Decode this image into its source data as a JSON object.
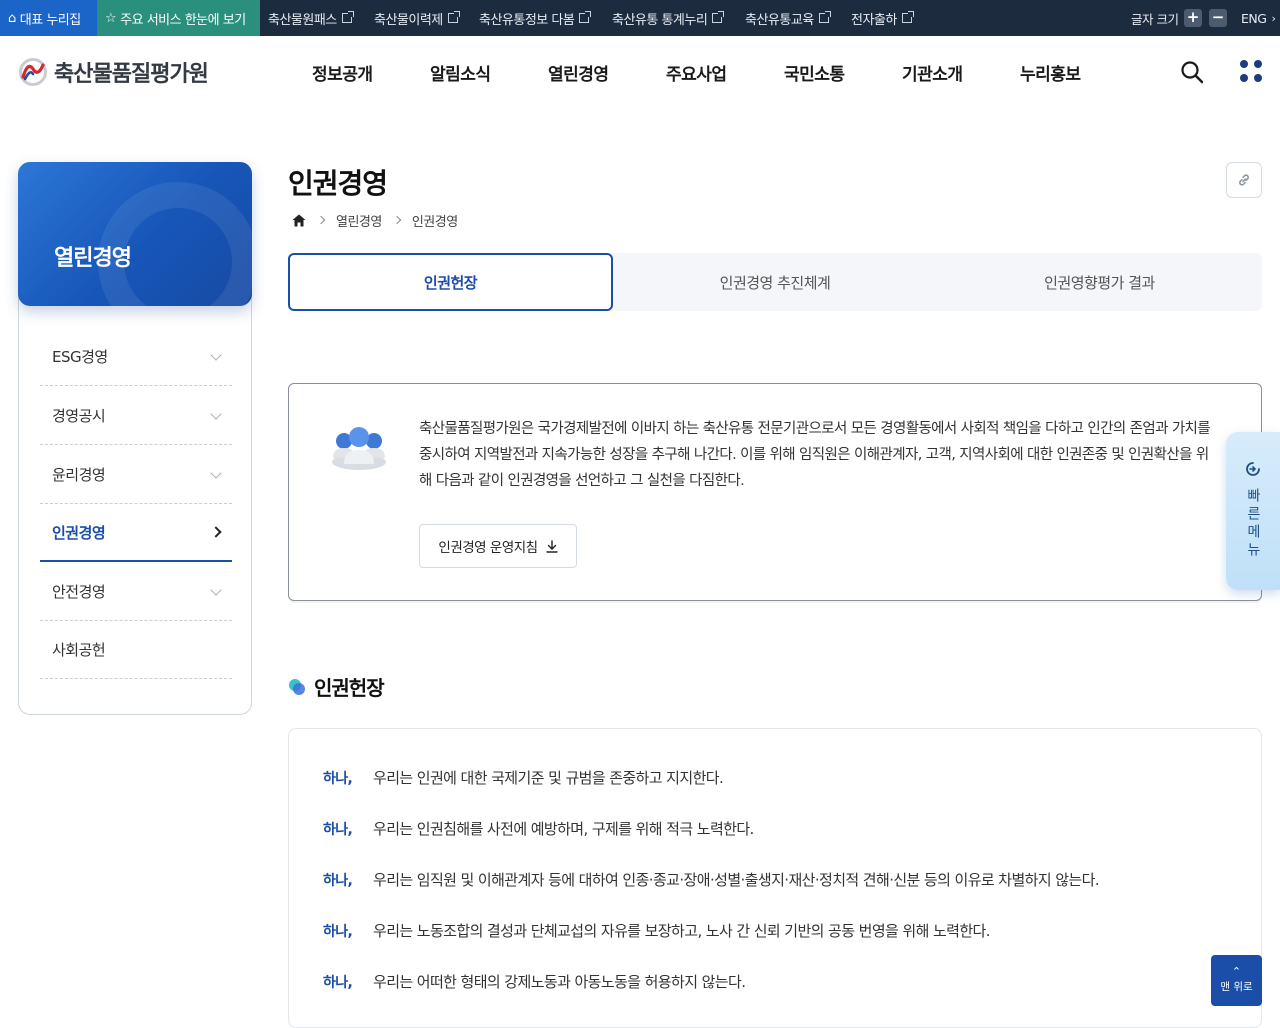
{
  "topbar": {
    "home": "대표 누리집",
    "services": "주요 서비스 한눈에 보기",
    "links": [
      "축산물원패스",
      "축산물이력제",
      "축산유통정보 다봄",
      "축산유통 통계누리",
      "축산유통교육",
      "전자출하"
    ],
    "font_size_label": "글자 크기",
    "plus": "+",
    "minus": "−",
    "lang": "ENG"
  },
  "header": {
    "logo_text": "축산물품질평가원",
    "nav": [
      "정보공개",
      "알림소식",
      "열린경영",
      "주요사업",
      "국민소통",
      "기관소개",
      "누리홍보"
    ],
    "search_icon": "search-icon",
    "menu_icon": "all-menu-icon"
  },
  "sidebar": {
    "title": "열린경영",
    "items": [
      {
        "label": "ESG경영",
        "state": "collapsed"
      },
      {
        "label": "경영공시",
        "state": "collapsed"
      },
      {
        "label": "윤리경영",
        "state": "collapsed"
      },
      {
        "label": "인권경영",
        "state": "active"
      },
      {
        "label": "안전경영",
        "state": "collapsed"
      },
      {
        "label": "사회공헌",
        "state": "none"
      }
    ]
  },
  "page": {
    "title": "인권경영",
    "breadcrumb": [
      "열린경영",
      "인권경영"
    ],
    "tabs": [
      "인권헌장",
      "인권경영 추진체계",
      "인권영향평가 결과"
    ],
    "active_tab": "인권헌장"
  },
  "intro": {
    "text": "축산물품질평가원은 국가경제발전에 이바지 하는 축산유통 전문기관으로서 모든 경영활동에서 사회적 책임을 다하고 인간의 존엄과 가치를 중시하여 지역발전과 지속가능한 성장을 추구해 나간다. 이를 위해 임직원은 이해관계자, 고객, 지역사회에 대한 인권존중 및 인권확산을 위해 다음과 같이 인권경영을 선언하고 그 실천을 다짐한다.",
    "download_label": "인권경영 운영지침"
  },
  "charter": {
    "title": "인권헌장",
    "lead": "하나,",
    "items": [
      "우리는 인권에 대한 국제기준 및 규범을 존중하고 지지한다.",
      "우리는 인권침해를 사전에 예방하며, 구제를 위해 적극 노력한다.",
      "우리는 임직원 및 이해관계자 등에 대하여 인종·종교·장애·성별·출생지·재산·정치적 견해·신분 등의 이유로 차별하지 않는다.",
      "우리는 노동조합의 결성과 단체교섭의 자유를 보장하고, 노사 간 신뢰 기반의 공동 번영을 위해 노력한다.",
      "우리는 어떠한 형태의 강제노동과 아동노동을 허용하지 않는다."
    ]
  },
  "quick_menu": {
    "label": "빠른메뉴"
  },
  "to_top": {
    "label": "맨 위로"
  },
  "colors": {
    "primary": "#1b4ea8",
    "topbar": "#1d2b3f",
    "home_bg": "#1b64c8",
    "service_bg": "#2a8f7d"
  }
}
